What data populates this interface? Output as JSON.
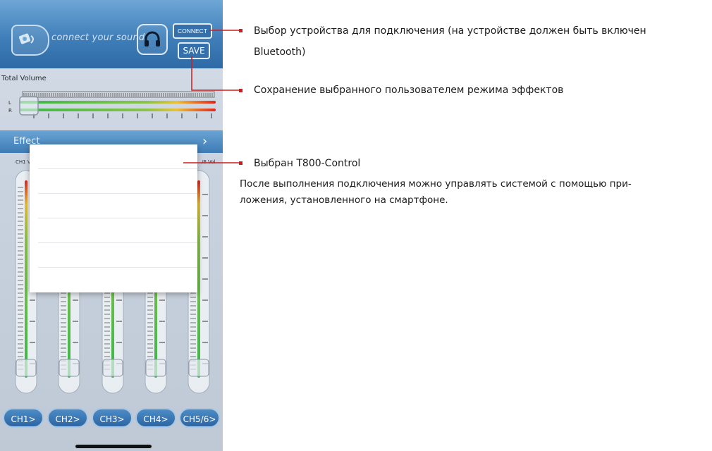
{
  "app": {
    "tagline": "connect your sound",
    "connect_label": "CONNECT",
    "save_label": "SAVE",
    "total_volume_label": "Total Volume",
    "meter_left": "L",
    "meter_right": "R",
    "effect_label": "Effect",
    "effect_chevron": "›",
    "ch_left_label": "CH1 V",
    "ch_right_label": "/6 Vol",
    "channel_buttons": [
      "CH1>",
      "CH2>",
      "CH3>",
      "CH4>",
      "CH5/6>"
    ]
  },
  "annotations": {
    "connect_line1": "Выбор устройства для подключения (на устройстве должен быть включен",
    "connect_line2": "Bluetooth)",
    "save": "Сохранение выбранного пользователем режима эффектов",
    "selected": "Выбран T800-Control",
    "note_line1": "После выполнения подключения можно управлять системой с помощью при-",
    "note_line2": "ложения, установленного на смартфоне."
  },
  "colors": {
    "header_blue": "#3f7fb9",
    "annotation_line": "#cc1e1e",
    "meter_green": "#39b54a",
    "meter_red": "#e0261f"
  },
  "icons": {
    "logo": "speaker-logo-icon",
    "headphones": "headphones-icon",
    "chevron": "chevron-right-icon"
  }
}
